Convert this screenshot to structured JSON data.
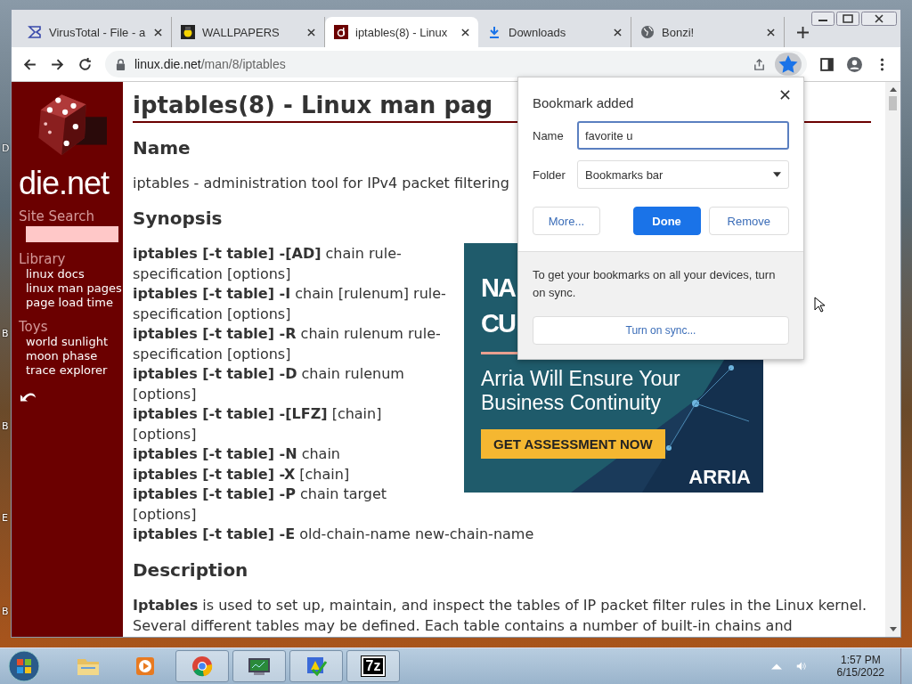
{
  "desktop_labels": [
    "D",
    "B",
    "B",
    "E",
    "B"
  ],
  "tabs": [
    {
      "kind": "sigma",
      "title": "VirusTotal - File - a",
      "selected": false
    },
    {
      "kind": "figure",
      "title": "WALLPAPERS",
      "selected": false
    },
    {
      "kind": "die",
      "title": "iptables(8) - Linux",
      "selected": true
    },
    {
      "kind": "download",
      "title": "Downloads",
      "selected": false
    },
    {
      "kind": "globe",
      "title": "Bonzi!",
      "selected": false
    }
  ],
  "address": {
    "host": "linux.die.net",
    "path": "/man/8/iptables"
  },
  "bookmarked": true,
  "sidebar": {
    "logo": "die.net",
    "search_label": "Site Search",
    "sections": [
      {
        "heading": "Library",
        "links": [
          "linux docs",
          "linux man pages",
          "page load time"
        ]
      },
      {
        "heading": "Toys",
        "links": [
          "world sunlight",
          "moon phase",
          "trace explorer"
        ]
      }
    ]
  },
  "page": {
    "title": "iptables(8) - Linux man pag",
    "name_heading": "Name",
    "name_text": "iptables - administration tool for IPv4 packet filtering",
    "synopsis_heading": "Synopsis",
    "synopsis": [
      "**iptables [-t table] -[AD]** chain rule-specification [options]",
      "**iptables [-t table] -I** chain [rulenum] rule-specification [options]",
      "**iptables [-t table] -R** chain rulenum rule-specification [options]",
      "**iptables [-t table] -D** chain rulenum [options]",
      "**iptables [-t table] -[LFZ]** [chain] [options]",
      "**iptables [-t table] -N** chain",
      "**iptables [-t table] -X** [chain]",
      "**iptables [-t table] -P** chain target [options]",
      "**iptables [-t table] -E** old-chain-name new-chain-name"
    ],
    "description_heading": "Description",
    "description": "**Iptables** is used to set up, maintain, and inspect the tables of IP packet filter rules in the Linux kernel. Several different tables may be defined. Each table contains a number of built-in chains and"
  },
  "ad": {
    "headline": [
      "NA",
      "CU"
    ],
    "tagline": "Arria Will Ensure Your Business Continuity",
    "button": "GET ASSESSMENT NOW",
    "brand": "ARRIA"
  },
  "bookmark_popup": {
    "title": "Bookmark added",
    "name_label": "Name",
    "name_value": "favorite u",
    "folder_label": "Folder",
    "folder_value": "Bookmarks bar",
    "buttons": [
      {
        "label": "More...",
        "primary": false
      },
      {
        "label": "Done",
        "primary": true
      },
      {
        "label": "Remove",
        "primary": false
      }
    ],
    "sync_text": "To get your bookmarks on all your devices, turn on sync.",
    "sync_button": "Turn on sync..."
  },
  "taskbar": {
    "apps": [
      {
        "kind": "folder",
        "running": false
      },
      {
        "kind": "player",
        "running": false
      },
      {
        "kind": "chrome",
        "running": true
      },
      {
        "kind": "monitor",
        "running": true
      },
      {
        "kind": "check",
        "running": true
      },
      {
        "kind": "archive",
        "running": true,
        "label": "7z"
      }
    ],
    "time": "1:57 PM",
    "date": "6/15/2022"
  }
}
